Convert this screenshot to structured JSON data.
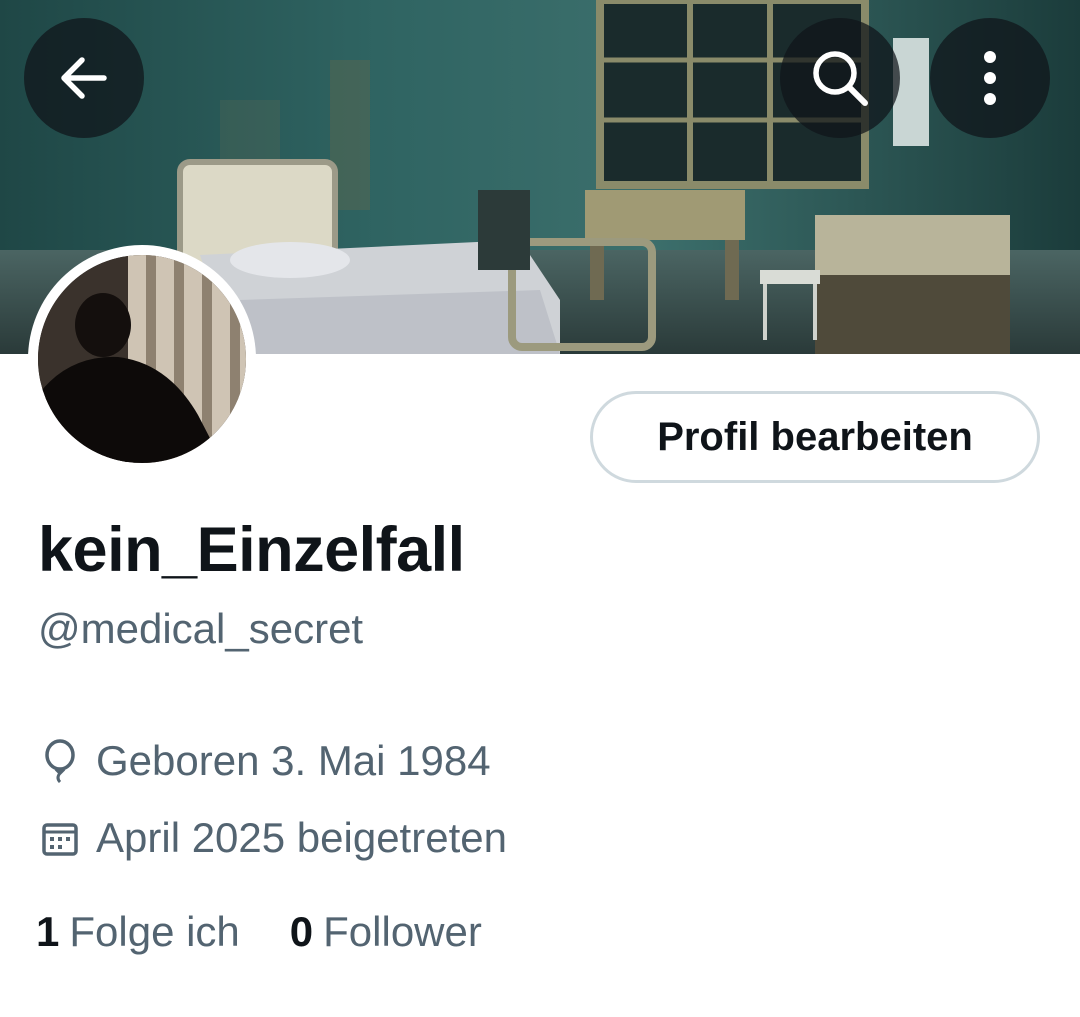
{
  "header": {
    "banner_icon": "abandoned-hospital-room-banner",
    "back_icon": "arrow-left-icon",
    "search_icon": "search-icon",
    "more_icon": "more-vertical-icon"
  },
  "profile": {
    "avatar_icon": "silhouette-avatar",
    "edit_button_label": "Profil bearbeiten",
    "display_name": "kein_Einzelfall",
    "handle": "@medical_secret",
    "birth_icon": "balloon-icon",
    "birth_text": "Geboren 3. Mai 1984",
    "joined_icon": "calendar-icon",
    "joined_text": "April 2025 beigetreten"
  },
  "stats": {
    "following_count": "1",
    "following_label": "Folge ich",
    "followers_count": "0",
    "followers_label": "Follower"
  },
  "colors": {
    "primary_text": "#0f1419",
    "secondary_text": "#536471",
    "button_border": "#cfd9de",
    "overlay_button": "#0f1419"
  }
}
